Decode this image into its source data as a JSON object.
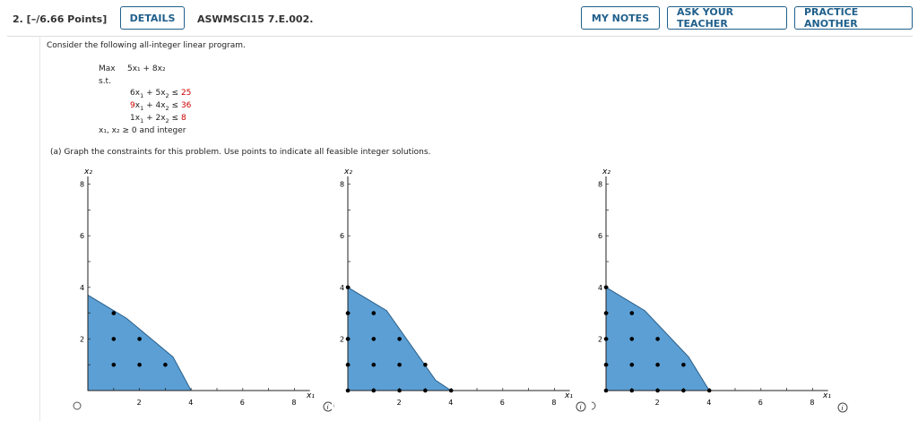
{
  "header": {
    "points": "2.  [–/6.66 Points]",
    "details_label": "DETAILS",
    "question_id": "ASWMSCI15 7.E.002.",
    "my_notes_label": "MY NOTES",
    "ask_teacher_label": "ASK YOUR TEACHER",
    "practice_label": "PRACTICE ANOTHER"
  },
  "question": {
    "intro": "Consider the following all-integer linear program.",
    "max_label": "Max",
    "st_label": "s.t.",
    "objective": "5x₁ + 8x₂",
    "constraints": [
      {
        "c1": "6",
        "c2": "5",
        "rhs": "25",
        "red": [
          "rhs"
        ]
      },
      {
        "c1": "9",
        "c2": "4",
        "rhs": "36",
        "red": [
          "c1",
          "rhs"
        ]
      },
      {
        "c1": "1",
        "c2": "2",
        "rhs": "8",
        "red": [
          "rhs"
        ]
      }
    ],
    "nonneg": "x₁, x₂ ≥ 0 and integer",
    "part_a": "(a)   Graph the constraints for this problem. Use points to indicate all feasible integer solutions."
  },
  "graphs": [
    {
      "name": "graph-1",
      "xlabel": "x₁",
      "ylabel": "x₂",
      "x_ticks": [
        "2",
        "4",
        "6",
        "8"
      ],
      "y_ticks": [
        "2",
        "4",
        "6",
        "8"
      ],
      "fill_color": "#5b9fd4",
      "region": [
        [
          0,
          0
        ],
        [
          0,
          3.7
        ],
        [
          1.5,
          2.8
        ],
        [
          3.3,
          1.3
        ],
        [
          4,
          0
        ]
      ],
      "points": [
        [
          1,
          1
        ],
        [
          2,
          1
        ],
        [
          3,
          1
        ],
        [
          1,
          2
        ],
        [
          2,
          2
        ],
        [
          1,
          3
        ]
      ]
    },
    {
      "name": "graph-2",
      "xlabel": "x₁",
      "ylabel": "x₂",
      "x_ticks": [
        "2",
        "4",
        "6",
        "8"
      ],
      "y_ticks": [
        "2",
        "4",
        "6",
        "8"
      ],
      "fill_color": "#5b9fd4",
      "region": [
        [
          0,
          0
        ],
        [
          0,
          4
        ],
        [
          1.5,
          3.1
        ],
        [
          3.4,
          0.4
        ],
        [
          4,
          0
        ]
      ],
      "points": [
        [
          0,
          0
        ],
        [
          1,
          0
        ],
        [
          2,
          0
        ],
        [
          3,
          0
        ],
        [
          4,
          0
        ],
        [
          0,
          1
        ],
        [
          1,
          1
        ],
        [
          2,
          1
        ],
        [
          3,
          1
        ],
        [
          0,
          2
        ],
        [
          1,
          2
        ],
        [
          2,
          2
        ],
        [
          0,
          3
        ],
        [
          1,
          3
        ],
        [
          0,
          4
        ]
      ]
    },
    {
      "name": "graph-3",
      "xlabel": "x₁",
      "ylabel": "x₂",
      "x_ticks": [
        "2",
        "4",
        "6",
        "8"
      ],
      "y_ticks": [
        "2",
        "4",
        "6",
        "8"
      ],
      "fill_color": "#5b9fd4",
      "region": [
        [
          0,
          0
        ],
        [
          0,
          4
        ],
        [
          1.5,
          3.1
        ],
        [
          3.2,
          1.3
        ],
        [
          4,
          0
        ]
      ],
      "points": [
        [
          0,
          0
        ],
        [
          1,
          0
        ],
        [
          2,
          0
        ],
        [
          3,
          0
        ],
        [
          4,
          0
        ],
        [
          0,
          1
        ],
        [
          1,
          1
        ],
        [
          2,
          1
        ],
        [
          3,
          1
        ],
        [
          0,
          2
        ],
        [
          1,
          2
        ],
        [
          2,
          2
        ],
        [
          0,
          3
        ],
        [
          1,
          3
        ],
        [
          0,
          4
        ]
      ]
    }
  ]
}
